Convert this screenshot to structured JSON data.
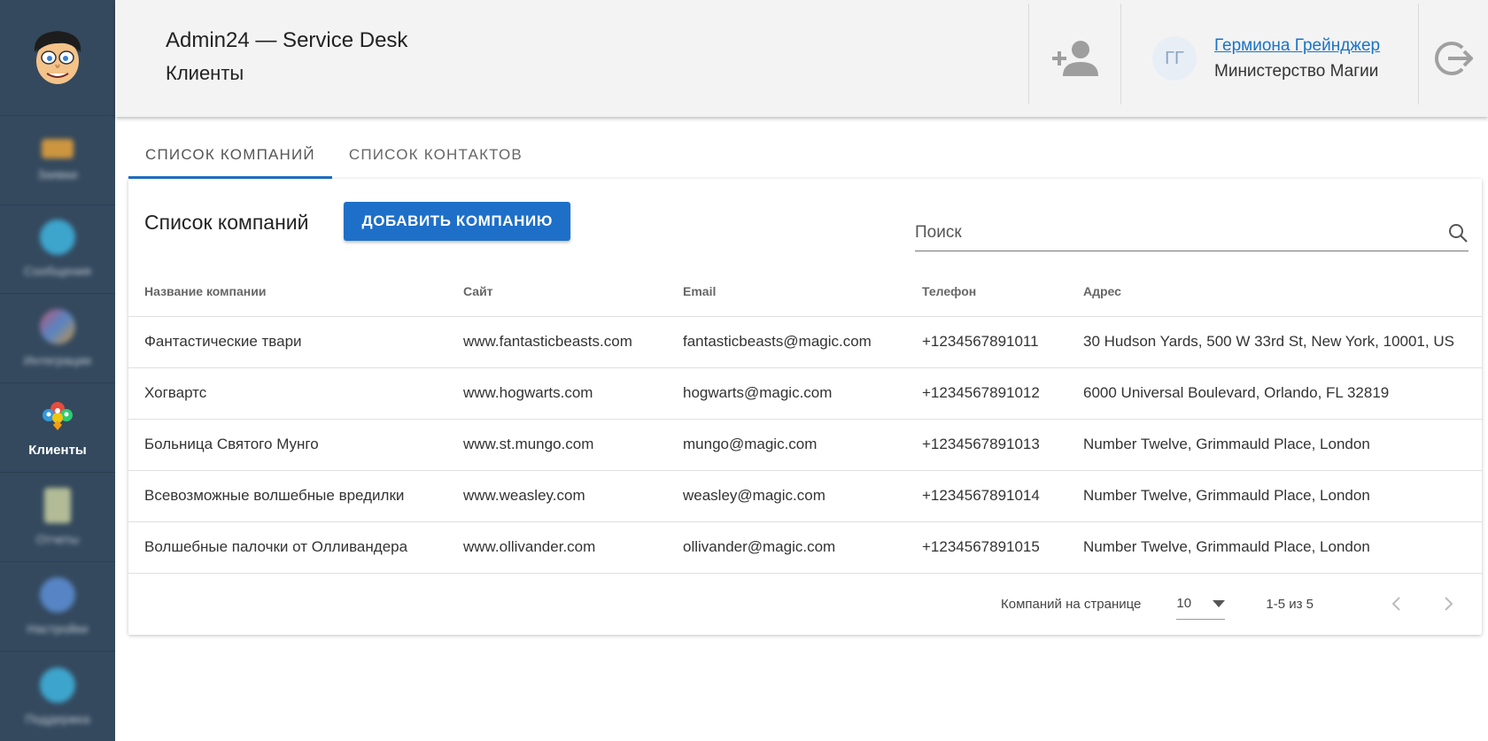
{
  "header": {
    "app_title": "Admin24 — Service Desk",
    "page_title": "Клиенты",
    "user": {
      "initials": "ГГ",
      "name": "Гермиона Грейнджер",
      "org": "Министерство Магии"
    }
  },
  "sidebar": {
    "items": [
      {
        "label": "Заявки",
        "icon": "megaphone-icon",
        "color": "#e8a33a",
        "blurred": true
      },
      {
        "label": "Сообщения",
        "icon": "chat-icon",
        "color": "#3fb5e0",
        "blurred": true
      },
      {
        "label": "Интеграции",
        "icon": "puzzle-icon",
        "color": "#d35b7a",
        "blurred": true
      },
      {
        "label": "Клиенты",
        "icon": "clients-icon",
        "color": "#e74c3c",
        "active": true
      },
      {
        "label": "Отчеты",
        "icon": "report-icon",
        "color": "#c8d0a0",
        "blurred": true
      },
      {
        "label": "Настройки",
        "icon": "gear-icon",
        "color": "#5d8fd6",
        "blurred": true
      },
      {
        "label": "Поддержка",
        "icon": "support-icon",
        "color": "#3fb5e0",
        "blurred": true
      }
    ]
  },
  "tabs": [
    {
      "label": "СПИСОК КОМПАНИЙ",
      "active": true
    },
    {
      "label": "СПИСОК КОНТАКТОВ",
      "active": false
    }
  ],
  "card": {
    "title": "Список компаний",
    "add_button": "ДОБАВИТЬ КОМПАНИЮ",
    "search_placeholder": "Поиск"
  },
  "table": {
    "columns": [
      "Название компании",
      "Сайт",
      "Email",
      "Телефон",
      "Адрес"
    ],
    "rows": [
      [
        "Фантастические твари",
        "www.fantasticbeasts.com",
        "fantasticbeasts@magic.com",
        "+1234567891011",
        "30 Hudson Yards, 500 W 33rd St, New York, 10001, US"
      ],
      [
        "Хогвартс",
        "www.hogwarts.com",
        "hogwarts@magic.com",
        "+1234567891012",
        "6000 Universal Boulevard, Orlando, FL 32819"
      ],
      [
        "Больница Святого Мунго",
        "www.st.mungo.com",
        "mungo@magic.com",
        "+1234567891013",
        "Number Twelve, Grimmauld Place, London"
      ],
      [
        "Всевозможные волшебные вредилки",
        "www.weasley.com",
        "weasley@magic.com",
        "+1234567891014",
        "Number Twelve, Grimmauld Place, London"
      ],
      [
        "Волшебные палочки от Олливандера",
        "www.ollivander.com",
        "ollivander@magic.com",
        "+1234567891015",
        "Number Twelve, Grimmauld Place, London"
      ]
    ]
  },
  "pagination": {
    "per_page_label": "Компаний на странице",
    "per_page_value": "10",
    "range": "1-5 из 5"
  },
  "colors": {
    "sidebar_bg": "#34495e",
    "accent": "#1e6fc8",
    "header_bg": "#f3f3f3"
  }
}
